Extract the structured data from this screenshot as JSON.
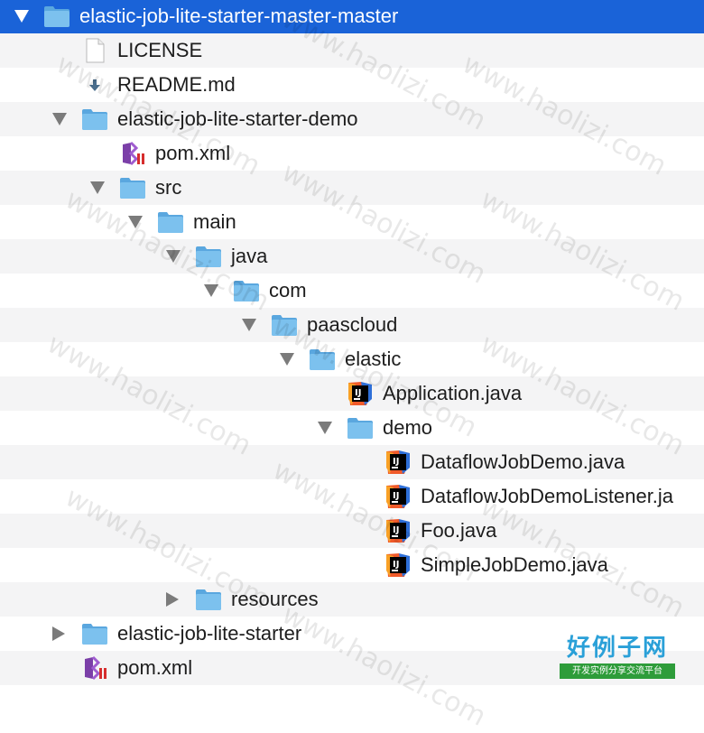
{
  "tree": {
    "rows": [
      {
        "label": "elastic-job-lite-starter-master-master",
        "icon": "folder-icon",
        "disclosure": "open",
        "depth": 0,
        "selected": true
      },
      {
        "label": "LICENSE",
        "icon": "document-icon",
        "disclosure": "none",
        "depth": 1
      },
      {
        "label": "README.md",
        "icon": "markdown-file-icon",
        "disclosure": "none",
        "depth": 1
      },
      {
        "label": "elastic-job-lite-starter-demo",
        "icon": "folder-icon",
        "disclosure": "open",
        "depth": 1
      },
      {
        "label": "pom.xml",
        "icon": "xml-file-icon",
        "disclosure": "none",
        "depth": 2
      },
      {
        "label": "src",
        "icon": "folder-icon",
        "disclosure": "open",
        "depth": 2
      },
      {
        "label": "main",
        "icon": "folder-icon",
        "disclosure": "open",
        "depth": 3
      },
      {
        "label": "java",
        "icon": "folder-icon",
        "disclosure": "open",
        "depth": 4
      },
      {
        "label": "com",
        "icon": "folder-icon",
        "disclosure": "open",
        "depth": 5
      },
      {
        "label": "paascloud",
        "icon": "folder-icon",
        "disclosure": "open",
        "depth": 6
      },
      {
        "label": "elastic",
        "icon": "folder-icon",
        "disclosure": "open",
        "depth": 7
      },
      {
        "label": "Application.java",
        "icon": "intellij-java-file-icon",
        "disclosure": "none",
        "depth": 8
      },
      {
        "label": "demo",
        "icon": "folder-icon",
        "disclosure": "open",
        "depth": 8
      },
      {
        "label": "DataflowJobDemo.java",
        "icon": "intellij-java-file-icon",
        "disclosure": "none",
        "depth": 9
      },
      {
        "label": "DataflowJobDemoListener.ja",
        "icon": "intellij-java-file-icon",
        "disclosure": "none",
        "depth": 9
      },
      {
        "label": "Foo.java",
        "icon": "intellij-java-file-icon",
        "disclosure": "none",
        "depth": 9
      },
      {
        "label": "SimpleJobDemo.java",
        "icon": "intellij-java-file-icon",
        "disclosure": "none",
        "depth": 9
      },
      {
        "label": "resources",
        "icon": "folder-icon",
        "disclosure": "closed",
        "depth": 4
      },
      {
        "label": "elastic-job-lite-starter",
        "icon": "folder-icon",
        "disclosure": "closed",
        "depth": 1
      },
      {
        "label": "pom.xml",
        "icon": "xml-file-icon",
        "disclosure": "none",
        "depth": 1
      }
    ]
  },
  "watermark": {
    "text": "www.haolizi.com"
  },
  "logo": {
    "title": "好例子网",
    "subtitle": "开发实例分享交流平台"
  },
  "colors": {
    "selection": "#1a63d8",
    "folder": "#7cc1ee",
    "stripe": "#f4f4f5",
    "logo_blue": "#2aa0d8",
    "logo_green": "#2e9c3a"
  }
}
